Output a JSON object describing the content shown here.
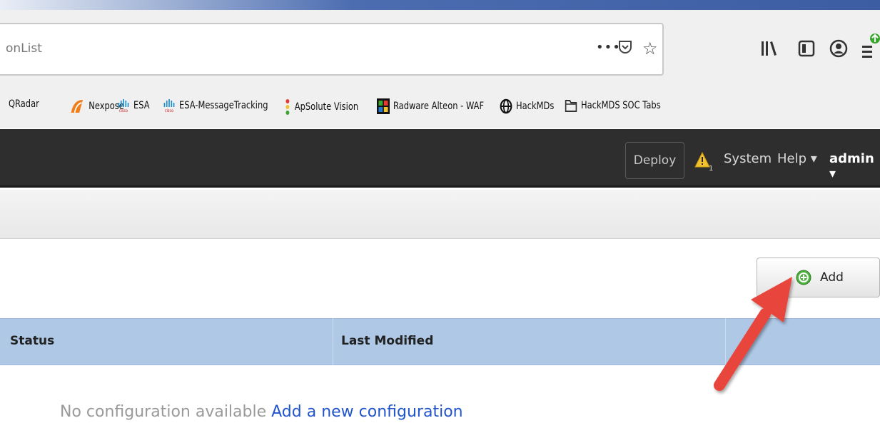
{
  "browser": {
    "url_text": "onList",
    "url_more": "•••",
    "bookmarks": [
      {
        "label": "QRadar",
        "icon": "qradar-icon"
      },
      {
        "label": "Nexpose",
        "icon": "nexpose-icon"
      },
      {
        "label": "ESA",
        "icon": "cisco-icon"
      },
      {
        "label": "ESA-MessageTracking",
        "icon": "cisco-icon"
      },
      {
        "label": "ApSolute Vision",
        "icon": "apsolute-icon"
      },
      {
        "label": "Radware Alteon - WAF",
        "icon": "radware-icon"
      },
      {
        "label": "HackMDs",
        "icon": "globe-icon"
      },
      {
        "label": "HackMDS SOC Tabs",
        "icon": "folder-icon"
      }
    ]
  },
  "header": {
    "deploy_label": "Deploy",
    "alert_count": "1",
    "system_label": "System",
    "help_label": "Help ▾",
    "user_label": "admin ▾"
  },
  "toolbar": {
    "add_label": "Add"
  },
  "table": {
    "columns": [
      "Status",
      "Last Modified"
    ],
    "empty_text": "No configuration available",
    "empty_link": "Add a new configuration"
  },
  "colors": {
    "header_bg": "#2e2e2e",
    "table_header_bg": "#aec8e6",
    "link": "#2255cc",
    "annotation_arrow": "#e8453c"
  }
}
